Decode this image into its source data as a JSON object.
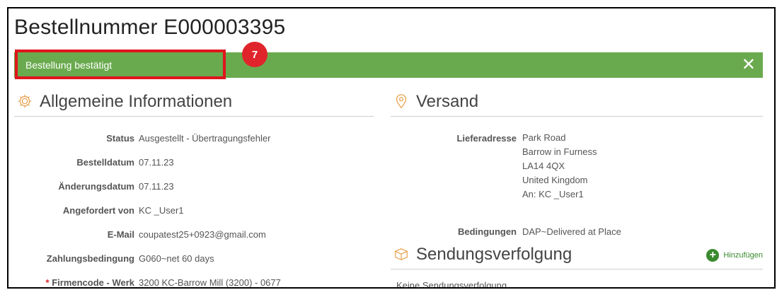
{
  "page": {
    "title": "Bestellnummer E000003395"
  },
  "banner": {
    "message": "Bestellung bestätigt",
    "close_glyph": "✕",
    "step_badge": "7",
    "color": "#6aaa4e",
    "highlight_color": "#e0151d"
  },
  "general": {
    "title": "Allgemeine Informationen",
    "fields": [
      {
        "label": "Status",
        "value": "Ausgestellt - Übertragungsfehler"
      },
      {
        "label": "Bestelldatum",
        "value": "07.11.23"
      },
      {
        "label": "Änderungsdatum",
        "value": "07.11.23"
      },
      {
        "label": "Angefordert von",
        "value": "KC _User1"
      },
      {
        "label": "E-Mail",
        "value": "coupatest25+0923@gmail.com"
      },
      {
        "label": "Zahlungsbedingung",
        "value": "G060~net 60 days"
      },
      {
        "label": "Firmencode - Werk",
        "value": "3200 KC-Barrow Mill (3200) - 0677",
        "required_mark": "*"
      }
    ]
  },
  "shipping": {
    "title": "Versand",
    "address_label": "Lieferadresse",
    "address_lines": [
      "Park Road",
      "Barrow in Furness",
      "LA14 4QX",
      "United Kingdom",
      "An: KC _User1"
    ],
    "terms_label": "Bedingungen",
    "terms_value": "DAP~Delivered at Place"
  },
  "tracking": {
    "title": "Sendungsverfolgung",
    "add_label": "Hinzufügen",
    "empty_text": "Keine Sendungsverfolgung."
  }
}
